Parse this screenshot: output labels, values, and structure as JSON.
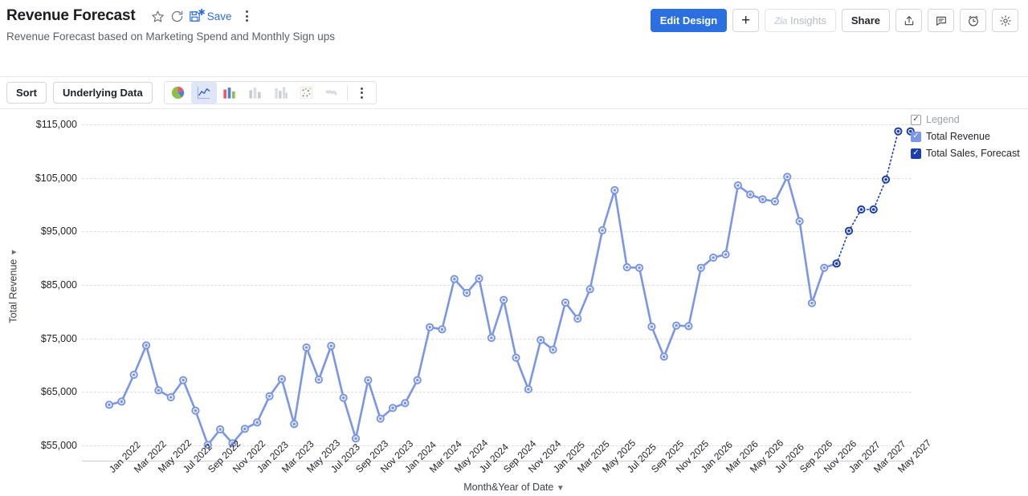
{
  "header": {
    "title": "Revenue Forecast",
    "subtitle": "Revenue Forecast based on Marketing Spend and Monthly Sign ups",
    "star_icon": "star-icon",
    "refresh_icon": "refresh-icon",
    "save_label": "Save",
    "save_icon": "save-icon",
    "more_icon": "more-options-icon"
  },
  "toolbar": {
    "edit_design": "Edit Design",
    "add": "+",
    "insights": "Insights",
    "insights_brand": "Zia",
    "share": "Share",
    "export_icon": "export-icon",
    "comment_icon": "comment-icon",
    "alert_icon": "alarm-clock-icon",
    "settings_icon": "gear-icon"
  },
  "subbar": {
    "sort": "Sort",
    "underlying_data": "Underlying Data",
    "chart_types": [
      {
        "name": "pie-chart-icon",
        "active": false,
        "enabled": true
      },
      {
        "name": "line-chart-icon",
        "active": true,
        "enabled": true
      },
      {
        "name": "bar-chart-icon",
        "active": false,
        "enabled": true
      },
      {
        "name": "stacked-bar-chart-icon",
        "active": false,
        "enabled": false
      },
      {
        "name": "grouped-bar-chart-icon",
        "active": false,
        "enabled": false
      },
      {
        "name": "scatter-chart-icon",
        "active": false,
        "enabled": false
      },
      {
        "name": "map-chart-icon",
        "active": false,
        "enabled": false
      }
    ],
    "more_icon": "more-chart-types-icon"
  },
  "legend": {
    "title": "Legend",
    "items": [
      {
        "label": "Total Revenue",
        "color": "#7b96e8",
        "checked": true
      },
      {
        "label": "Total Sales, Forecast",
        "color": "#1c3fb0",
        "checked": true
      }
    ]
  },
  "chart_data": {
    "type": "line",
    "title": "Revenue Forecast",
    "xlabel": "Month&Year of Date",
    "ylabel": "Total Revenue",
    "ylim": [
      50000,
      118000
    ],
    "yticks": [
      "$55,000",
      "$65,000",
      "$75,000",
      "$85,000",
      "$95,000",
      "$105,000",
      "$115,000"
    ],
    "ytick_values": [
      55000,
      65000,
      75000,
      85000,
      95000,
      105000,
      115000
    ],
    "grid": true,
    "legend_position": "right",
    "x": [
      "Jan 2022",
      "Feb 2022",
      "Mar 2022",
      "Apr 2022",
      "May 2022",
      "Jun 2022",
      "Jul 2022",
      "Aug 2022",
      "Sep 2022",
      "Oct 2022",
      "Nov 2022",
      "Dec 2022",
      "Jan 2023",
      "Feb 2023",
      "Mar 2023",
      "Apr 2023",
      "May 2023",
      "Jun 2023",
      "Jul 2023",
      "Aug 2023",
      "Sep 2023",
      "Oct 2023",
      "Nov 2023",
      "Dec 2023",
      "Jan 2024",
      "Feb 2024",
      "Mar 2024",
      "Apr 2024",
      "May 2024",
      "Jun 2024",
      "Jul 2024",
      "Aug 2024",
      "Sep 2024",
      "Oct 2024",
      "Nov 2024",
      "Dec 2024",
      "Jan 2025",
      "Feb 2025",
      "Mar 2025",
      "Apr 2025",
      "May 2025",
      "Jun 2025",
      "Jul 2025",
      "Aug 2025",
      "Sep 2025",
      "Oct 2025",
      "Nov 2025",
      "Dec 2025",
      "Jan 2026",
      "Feb 2026",
      "Mar 2026",
      "Apr 2026",
      "May 2026",
      "Jun 2026",
      "Jul 2026",
      "Aug 2026",
      "Sep 2026",
      "Oct 2026",
      "Nov 2026",
      "Dec 2026",
      "Jan 2027",
      "Feb 2027",
      "Mar 2027",
      "Apr 2027",
      "May 2027"
    ],
    "xtick_labels": [
      "Jan 2022",
      "Mar 2022",
      "May 2022",
      "Jul 2022",
      "Sep 2022",
      "Nov 2022",
      "Jan 2023",
      "Mar 2023",
      "May 2023",
      "Jul 2023",
      "Sep 2023",
      "Nov 2023",
      "Jan 2024",
      "Mar 2024",
      "May 2024",
      "Jul 2024",
      "Sep 2024",
      "Nov 2024",
      "Jan 2025",
      "Mar 2025",
      "May 2025",
      "Jul 2025",
      "Sep 2025",
      "Nov 2025",
      "Jan 2026",
      "Mar 2026",
      "May 2026",
      "Jul 2026",
      "Sep 2026",
      "Nov 2026",
      "Jan 2027",
      "Mar 2027",
      "May 2027"
    ],
    "series": [
      {
        "name": "Total Revenue",
        "color": "#7b96e8",
        "style": "solid",
        "values": [
          62600,
          63200,
          68200,
          73700,
          65300,
          64000,
          67200,
          61500,
          55100,
          58000,
          55400,
          58100,
          59300,
          64200,
          67400,
          59000,
          73300,
          67300,
          73600,
          63900,
          56300,
          67200,
          60000,
          62000,
          62900,
          67200,
          77100,
          76700,
          86100,
          83500,
          86200,
          75100,
          82200,
          71400,
          65500,
          74700,
          72900,
          81700,
          78700,
          84200,
          95200,
          102700,
          88300,
          88200,
          77200,
          71600,
          77400,
          77300,
          88200,
          90100,
          90700,
          103600,
          101900,
          101000,
          100600,
          105200,
          96900,
          81600,
          88200,
          89000,
          null,
          null,
          null,
          null,
          null
        ]
      },
      {
        "name": "Total Sales, Forecast",
        "color": "#1c3fb0",
        "style": "dotted",
        "values": [
          null,
          null,
          null,
          null,
          null,
          null,
          null,
          null,
          null,
          null,
          null,
          null,
          null,
          null,
          null,
          null,
          null,
          null,
          null,
          null,
          null,
          null,
          null,
          null,
          null,
          null,
          null,
          null,
          null,
          null,
          null,
          null,
          null,
          null,
          null,
          null,
          null,
          null,
          null,
          null,
          null,
          null,
          null,
          null,
          null,
          null,
          null,
          null,
          null,
          null,
          null,
          null,
          null,
          null,
          null,
          null,
          null,
          null,
          null,
          89000,
          95100,
          99100,
          99100,
          104700,
          113700
        ]
      }
    ],
    "extra_points": [
      {
        "series": "Total Sales, Forecast",
        "x": "May 2027",
        "value": 113700,
        "x_offset": 1
      }
    ]
  }
}
